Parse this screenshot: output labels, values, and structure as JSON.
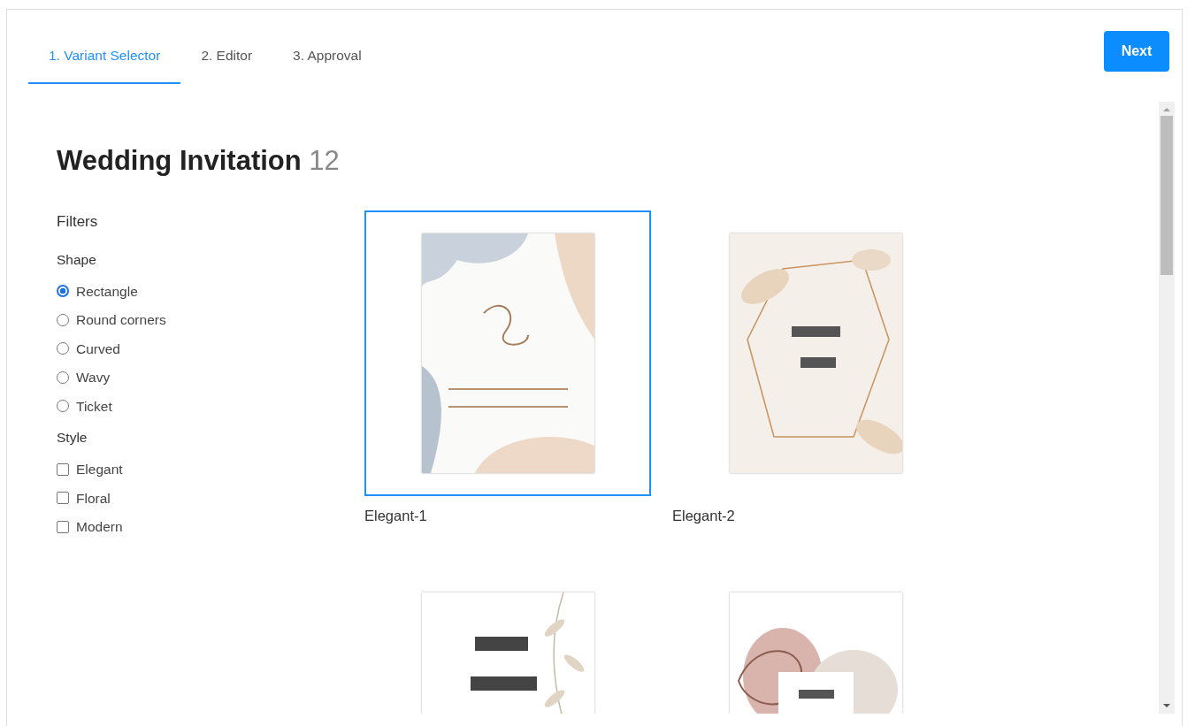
{
  "tabs": [
    {
      "label": "1. Variant Selector",
      "selected": true
    },
    {
      "label": "2. Editor",
      "selected": false
    },
    {
      "label": "3. Approval",
      "selected": false
    }
  ],
  "next_button": "Next",
  "heading": {
    "title": "Wedding Invitation",
    "count": "12"
  },
  "filters": {
    "title": "Filters",
    "groups": [
      {
        "title": "Shape",
        "kind": "radio",
        "options": [
          {
            "label": "Rectangle",
            "selected": true
          },
          {
            "label": "Round corners",
            "selected": false
          },
          {
            "label": "Curved",
            "selected": false
          },
          {
            "label": "Wavy",
            "selected": false
          },
          {
            "label": "Ticket",
            "selected": false
          }
        ]
      },
      {
        "title": "Style",
        "kind": "checkbox",
        "options": [
          {
            "label": "Elegant",
            "checked": false
          },
          {
            "label": "Floral",
            "checked": false
          },
          {
            "label": "Modern",
            "checked": false
          }
        ]
      }
    ]
  },
  "variants": [
    {
      "label": "Elegant-1",
      "selected": true
    },
    {
      "label": "Elegant-2",
      "selected": false
    },
    {
      "selected": false
    },
    {
      "selected": false
    }
  ]
}
